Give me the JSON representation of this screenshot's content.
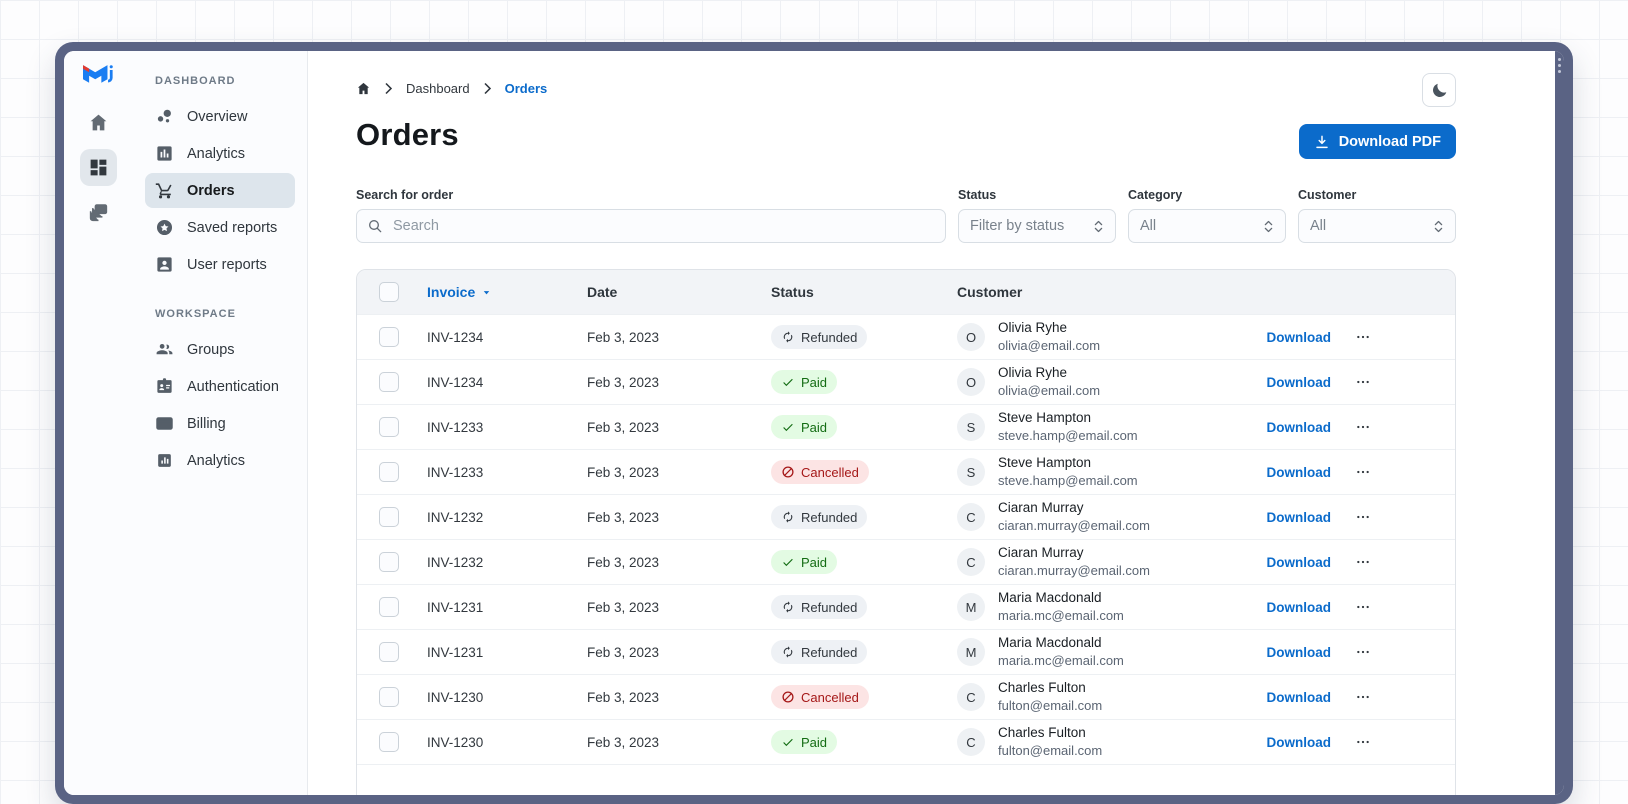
{
  "sidebar": {
    "rail": [
      {
        "icon": "home-icon",
        "selected": false
      },
      {
        "icon": "dashboard-icon",
        "selected": true
      },
      {
        "icon": "window-stack-icon",
        "selected": false
      }
    ],
    "sections": [
      {
        "label": "DASHBOARD",
        "items": [
          {
            "icon": "bubble-chart-icon",
            "label": "Overview",
            "selected": false
          },
          {
            "icon": "bar-chart-icon",
            "label": "Analytics",
            "selected": false
          },
          {
            "icon": "cart-icon",
            "label": "Orders",
            "selected": true
          },
          {
            "icon": "star-circle-icon",
            "label": "Saved reports",
            "selected": false
          },
          {
            "icon": "person-box-icon",
            "label": "User reports",
            "selected": false
          }
        ]
      },
      {
        "label": "WORKSPACE",
        "items": [
          {
            "icon": "groups-icon",
            "label": "Groups",
            "selected": false
          },
          {
            "icon": "badge-icon",
            "label": "Authentication",
            "selected": false
          },
          {
            "icon": "credit-card-icon",
            "label": "Billing",
            "selected": false
          },
          {
            "icon": "chart-box-icon",
            "label": "Analytics",
            "selected": false
          }
        ]
      }
    ]
  },
  "header": {
    "breadcrumb": {
      "home_icon": "home-icon",
      "separator_icon": "chevron-right-icon",
      "items": [
        "Dashboard",
        "Orders"
      ]
    },
    "theme_toggle_icon": "moon-icon",
    "title": "Orders",
    "download_button": {
      "icon": "download-icon",
      "label": "Download PDF"
    }
  },
  "filters": {
    "search": {
      "label": "Search for order",
      "placeholder": "Search",
      "icon": "search-icon"
    },
    "select_icon": "unfold-more-icon",
    "selects": [
      {
        "label": "Status",
        "value": "Filter by status"
      },
      {
        "label": "Category",
        "value": "All"
      },
      {
        "label": "Customer",
        "value": "All"
      }
    ]
  },
  "table": {
    "columns": [
      "Invoice",
      "Date",
      "Status",
      "Customer"
    ],
    "sorted_column": "Invoice",
    "sort_icon": "caret-down-icon",
    "status_icons": {
      "Refunded": "refresh-icon",
      "Paid": "check-icon",
      "Cancelled": "block-icon"
    },
    "row_action_label": "Download",
    "row_menu_icon": "ellipsis-icon",
    "rows": [
      {
        "invoice": "INV-1234",
        "date": "Feb 3, 2023",
        "status": "Refunded",
        "avatar": "O",
        "name": "Olivia Ryhe",
        "email": "olivia@email.com"
      },
      {
        "invoice": "INV-1234",
        "date": "Feb 3, 2023",
        "status": "Paid",
        "avatar": "O",
        "name": "Olivia Ryhe",
        "email": "olivia@email.com"
      },
      {
        "invoice": "INV-1233",
        "date": "Feb 3, 2023",
        "status": "Paid",
        "avatar": "S",
        "name": "Steve Hampton",
        "email": "steve.hamp@email.com"
      },
      {
        "invoice": "INV-1233",
        "date": "Feb 3, 2023",
        "status": "Cancelled",
        "avatar": "S",
        "name": "Steve Hampton",
        "email": "steve.hamp@email.com"
      },
      {
        "invoice": "INV-1232",
        "date": "Feb 3, 2023",
        "status": "Refunded",
        "avatar": "C",
        "name": "Ciaran Murray",
        "email": "ciaran.murray@email.com"
      },
      {
        "invoice": "INV-1232",
        "date": "Feb 3, 2023",
        "status": "Paid",
        "avatar": "C",
        "name": "Ciaran Murray",
        "email": "ciaran.murray@email.com"
      },
      {
        "invoice": "INV-1231",
        "date": "Feb 3, 2023",
        "status": "Refunded",
        "avatar": "M",
        "name": "Maria Macdonald",
        "email": "maria.mc@email.com"
      },
      {
        "invoice": "INV-1231",
        "date": "Feb 3, 2023",
        "status": "Refunded",
        "avatar": "M",
        "name": "Maria Macdonald",
        "email": "maria.mc@email.com"
      },
      {
        "invoice": "INV-1230",
        "date": "Feb 3, 2023",
        "status": "Cancelled",
        "avatar": "C",
        "name": "Charles Fulton",
        "email": "fulton@email.com"
      },
      {
        "invoice": "INV-1230",
        "date": "Feb 3, 2023",
        "status": "Paid",
        "avatar": "C",
        "name": "Charles Fulton",
        "email": "fulton@email.com"
      }
    ]
  },
  "colors": {
    "primary": "#0b6bcb",
    "frame": "#5a6384",
    "success_bg": "#e3fbe3",
    "success_text": "#136c13",
    "danger_bg": "#fce4e4",
    "danger_text": "#a51818",
    "neutral_chip_bg": "#eef1f5",
    "neutral_chip_text": "#32383e",
    "selected_nav_bg": "#dde5ec"
  }
}
